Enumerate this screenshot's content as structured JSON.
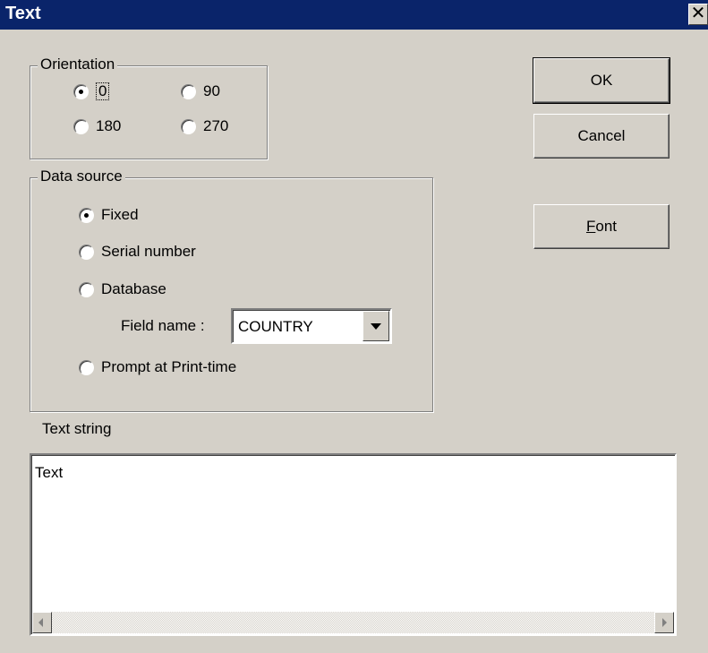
{
  "window": {
    "title": "Text",
    "close_symbol": "✕"
  },
  "orientation": {
    "label": "Orientation",
    "options": [
      "0",
      "90",
      "180",
      "270"
    ],
    "selected": "0"
  },
  "data_source": {
    "label": "Data source",
    "options": [
      "Fixed",
      "Serial number",
      "Database",
      "Prompt at Print-time"
    ],
    "selected": "Fixed",
    "field_name_label": "Field name :",
    "field_name_value": "COUNTRY"
  },
  "buttons": {
    "ok": "OK",
    "cancel": "Cancel",
    "font_mnemonic": "F",
    "font_rest": "ont"
  },
  "text_string": {
    "label": "Text string",
    "value": "Text"
  }
}
